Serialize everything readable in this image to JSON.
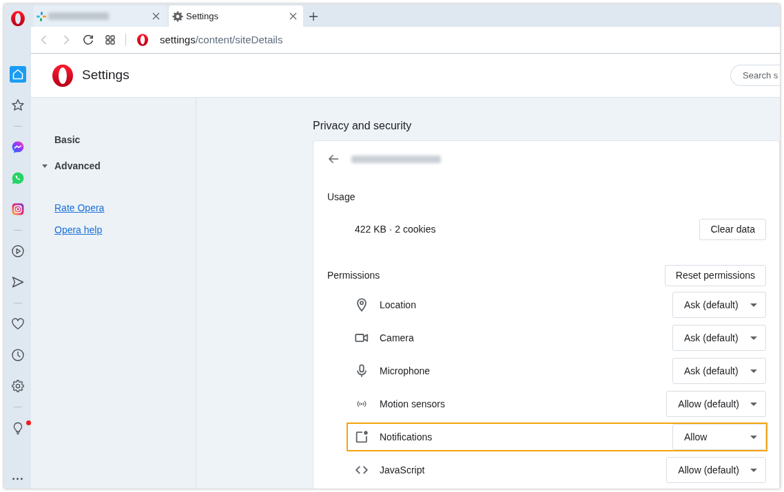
{
  "browser": {
    "tabs": [
      {
        "kind": "page",
        "redacted": true,
        "selected": false
      },
      {
        "kind": "settings",
        "title": "Settings",
        "redacted": false,
        "selected": true
      }
    ],
    "toolbar": [
      {
        "kind": "back",
        "disabled": true
      },
      {
        "kind": "forward",
        "disabled": true
      },
      {
        "kind": "reload",
        "disabled": false
      },
      {
        "kind": "tabs",
        "disabled": false
      }
    ],
    "address": {
      "host": "settings",
      "path": "/content/siteDetails"
    },
    "sidebar": [
      {
        "kind": "home",
        "selected": true,
        "badge": false
      },
      {
        "kind": "bookmarks",
        "selected": false,
        "badge": false
      },
      {
        "kind": "separator"
      },
      {
        "kind": "chat",
        "selected": false,
        "badge": false
      },
      {
        "kind": "call",
        "selected": false,
        "badge": false
      },
      {
        "kind": "photos",
        "selected": false,
        "badge": false
      },
      {
        "kind": "separator"
      },
      {
        "kind": "player",
        "selected": false,
        "badge": false
      },
      {
        "kind": "send",
        "selected": false,
        "badge": false
      },
      {
        "kind": "separator"
      },
      {
        "kind": "favorites",
        "selected": false,
        "badge": false
      },
      {
        "kind": "history",
        "selected": false,
        "badge": false
      },
      {
        "kind": "settings",
        "selected": false,
        "badge": false
      },
      {
        "kind": "separator"
      },
      {
        "kind": "tips",
        "selected": false,
        "badge": true
      },
      {
        "kind": "more",
        "selected": false,
        "badge": false
      }
    ]
  },
  "settings": {
    "title": "Settings",
    "search": {
      "placeholder": "Search s"
    },
    "nav": [
      {
        "label": "Basic",
        "kind": "section"
      },
      {
        "label": "Advanced",
        "kind": "group",
        "expanded": true
      }
    ],
    "links": [
      {
        "label": "Rate Opera"
      },
      {
        "label": "Opera help"
      }
    ],
    "section_title": "Privacy and security",
    "site": {
      "redacted": true
    },
    "usage": {
      "heading": "Usage",
      "summary": "422 KB · 2 cookies",
      "button": "Clear data"
    },
    "permissions": {
      "heading": "Permissions",
      "button": "Reset permissions",
      "items": [
        {
          "kind": "location",
          "label": "Location",
          "value": "Ask (default)",
          "highlighted": false
        },
        {
          "kind": "camera",
          "label": "Camera",
          "value": "Ask (default)",
          "highlighted": false
        },
        {
          "kind": "microphone",
          "label": "Microphone",
          "value": "Ask (default)",
          "highlighted": false
        },
        {
          "kind": "motion",
          "label": "Motion sensors",
          "value": "Allow (default)",
          "highlighted": false
        },
        {
          "kind": "notifications",
          "label": "Notifications",
          "value": "Allow",
          "highlighted": true
        },
        {
          "kind": "javascript",
          "label": "JavaScript",
          "value": "Allow (default)",
          "highlighted": false
        }
      ]
    }
  }
}
